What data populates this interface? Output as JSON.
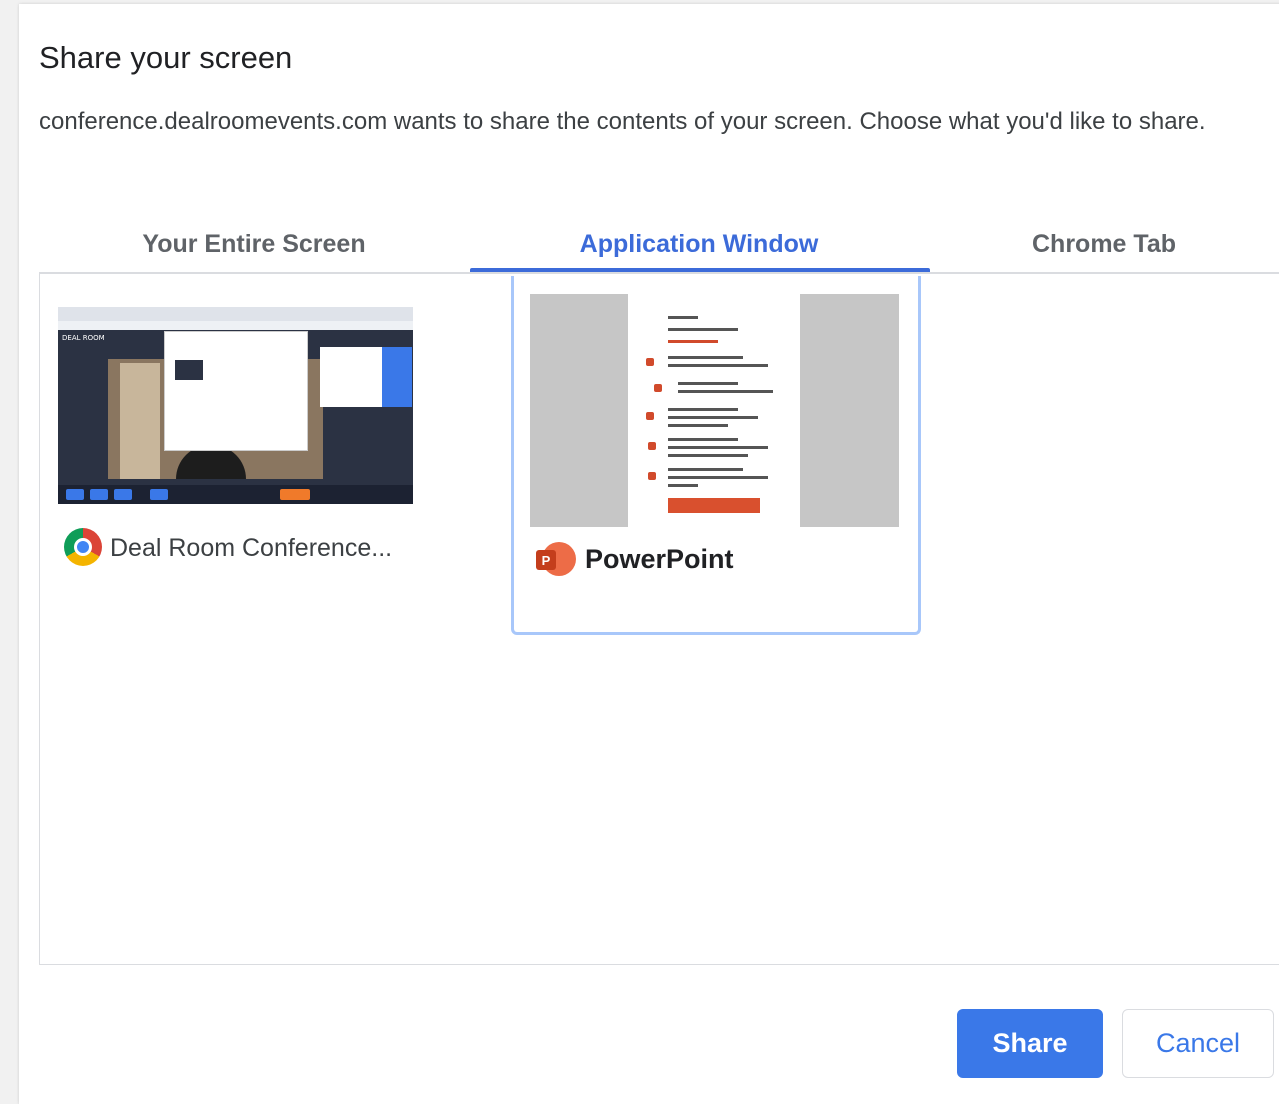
{
  "dialog": {
    "title": "Share your screen",
    "description": "conference.dealroomevents.com wants to share the contents of your screen. Choose what you'd like to share."
  },
  "tabs": [
    {
      "label": "Your Entire Screen",
      "selected": false
    },
    {
      "label": "Application Window",
      "selected": true
    },
    {
      "label": "Chrome Tab",
      "selected": false
    }
  ],
  "sources": [
    {
      "label": "Deal Room Conference...",
      "icon": "chrome-icon",
      "selected": false
    },
    {
      "label": "PowerPoint",
      "icon": "powerpoint-icon",
      "selected": true
    }
  ],
  "buttons": {
    "share": "Share",
    "cancel": "Cancel"
  },
  "colors": {
    "accent": "#3a78e8",
    "selected_tab": "#3c6bd9",
    "selected_border": "#a8c7fa"
  }
}
